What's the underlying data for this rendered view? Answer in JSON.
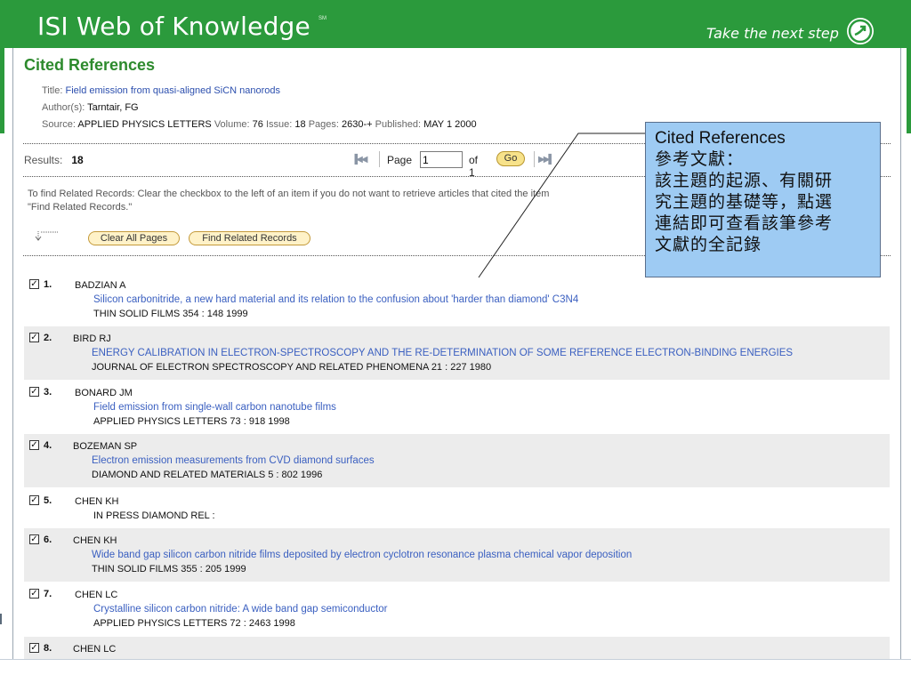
{
  "banner": {
    "brand": "ISI Web of Knowledge",
    "brand_mark": "SM",
    "tagline": "Take the next step",
    "tagline_icon": "arrow-circle-icon",
    "color": "#2b9a3c"
  },
  "header": {
    "title": "Cited References",
    "title_label": "Title:",
    "title_value": "Field emission from quasi-aligned SiCN nanorods",
    "authors_label": "Author(s):",
    "authors_value": "Tarntair, FG",
    "source_label": "Source:",
    "source_journal": "APPLIED PHYSICS LETTERS",
    "volume_label": "Volume:",
    "volume_value": "76",
    "issue_label": "Issue:",
    "issue_value": "18",
    "pages_label": "Pages:",
    "pages_value": "2630-+",
    "published_label": "Published:",
    "published_value": "MAY 1 2000"
  },
  "results": {
    "label": "Results:",
    "count": "18"
  },
  "pager": {
    "page_label": "Page",
    "page_value": "1",
    "of_label": "of 1",
    "go_label": "Go"
  },
  "hint": {
    "line1": "To find Related Records: Clear the checkbox to the left of an item if you do not want to retrieve articles that cited the item",
    "line2": "\"Find Related Records.\""
  },
  "buttons": {
    "clear_all": "Clear All Pages",
    "find_related": "Find Related Records"
  },
  "records": [
    {
      "num": "1.",
      "author": "BADZIAN A",
      "title": "Silicon carbonitride, a new hard material and its relation to the confusion about 'harder than diamond' C3N4",
      "source": "THIN SOLID FILMS 354 : 148 1999"
    },
    {
      "num": "2.",
      "author": "BIRD RJ",
      "title": "ENERGY CALIBRATION IN ELECTRON-SPECTROSCOPY AND THE RE-DETERMINATION OF SOME REFERENCE ELECTRON-BINDING ENERGIES",
      "source": "JOURNAL OF ELECTRON SPECTROSCOPY AND RELATED PHENOMENA 21 : 227 1980"
    },
    {
      "num": "3.",
      "author": "BONARD JM",
      "title": "Field emission from single-wall carbon nanotube films",
      "source": "APPLIED PHYSICS LETTERS 73 : 918 1998"
    },
    {
      "num": "4.",
      "author": "BOZEMAN SP",
      "title": "Electron emission measurements from CVD diamond surfaces",
      "source": "DIAMOND AND RELATED MATERIALS 5 : 802 1996"
    },
    {
      "num": "5.",
      "author": "CHEN KH",
      "title": "",
      "source": "IN PRESS DIAMOND REL :"
    },
    {
      "num": "6.",
      "author": "CHEN KH",
      "title": "Wide band gap silicon carbon nitride films deposited by electron cyclotron resonance plasma chemical vapor deposition",
      "source": "THIN SOLID FILMS 355 : 205 1999"
    },
    {
      "num": "7.",
      "author": "CHEN LC",
      "title": "Crystalline silicon carbon nitride: A wide band gap semiconductor",
      "source": "APPLIED PHYSICS LETTERS 72 : 2463 1998"
    },
    {
      "num": "8.",
      "author": "CHEN LC",
      "title": "",
      "source": ""
    }
  ],
  "callout": {
    "title": "Cited References",
    "line1": "參考文獻：",
    "line2": "該主題的起源、有關研",
    "line3": "究主題的基礎等，點選",
    "line4": "連結即可查看該筆參考",
    "line5": "文獻的全記錄",
    "color": "#9ecbf3"
  },
  "checkbox_mark": "✓"
}
